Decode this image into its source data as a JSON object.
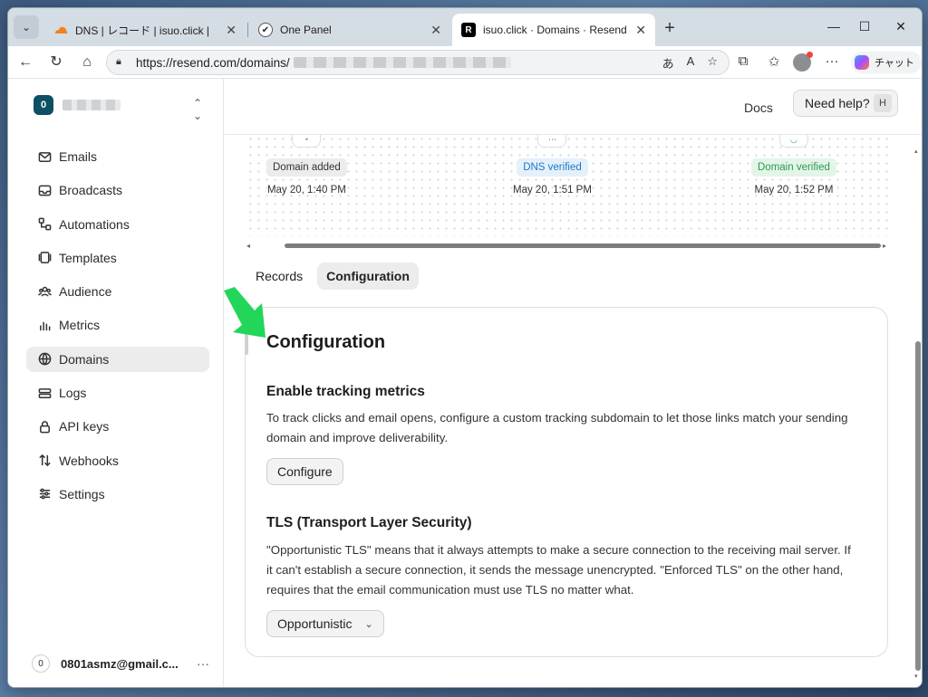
{
  "browser": {
    "tabs": [
      {
        "title": "DNS | レコード | isuo.click |",
        "favicon": "cloudflare-icon",
        "color": "#f38020"
      },
      {
        "title": "One Panel",
        "favicon": "one-panel-icon",
        "color": "#2b2b2b"
      },
      {
        "title": "isuo.click · Domains · Resend",
        "favicon": "resend-icon",
        "color": "#000000"
      }
    ],
    "url": "https://resend.com/domains/",
    "copilot_label": "チャット"
  },
  "sidebar": {
    "team_initial": "0",
    "items": [
      {
        "label": "Emails",
        "icon": "mail-icon"
      },
      {
        "label": "Broadcasts",
        "icon": "inbox-icon"
      },
      {
        "label": "Automations",
        "icon": "workflow-icon"
      },
      {
        "label": "Templates",
        "icon": "template-icon"
      },
      {
        "label": "Audience",
        "icon": "users-icon"
      },
      {
        "label": "Metrics",
        "icon": "bar-chart-icon"
      },
      {
        "label": "Domains",
        "icon": "globe-icon",
        "active": true
      },
      {
        "label": "Logs",
        "icon": "logs-icon"
      },
      {
        "label": "API keys",
        "icon": "lock-icon"
      },
      {
        "label": "Webhooks",
        "icon": "webhook-icon"
      },
      {
        "label": "Settings",
        "icon": "settings-icon"
      }
    ],
    "user": {
      "initial": "0",
      "email": "0801asmz@gmail.c...",
      "more": "···"
    }
  },
  "topbar": {
    "docs": "Docs",
    "help": "Need help?",
    "help_key": "H"
  },
  "timeline": [
    {
      "label": "Domain added",
      "time": "May 20, 1:40 PM",
      "style": "grey"
    },
    {
      "label": "DNS verified",
      "time": "May 20, 1:51 PM",
      "style": "blue"
    },
    {
      "label": "Domain verified",
      "time": "May 20, 1:52 PM",
      "style": "green"
    }
  ],
  "tabs": [
    {
      "label": "Records",
      "active": false
    },
    {
      "label": "Configuration",
      "active": true
    }
  ],
  "config": {
    "title": "Configuration",
    "tracking": {
      "heading": "Enable tracking metrics",
      "description": "To track clicks and email opens, configure a custom tracking subdomain to let those links match your sending domain and improve deliverability.",
      "button": "Configure"
    },
    "tls": {
      "heading": "TLS (Transport Layer Security)",
      "description": "\"Opportunistic TLS\" means that it always attempts to make a secure connection to the receiving mail server. If it can't establish a secure connection, it sends the message unencrypted. \"Enforced TLS\" on the other hand, requires that the email communication must use TLS no matter what.",
      "selected": "Opportunistic"
    }
  },
  "colors": {
    "accent_arrow": "#22d65a",
    "team_badge": "#0d4f63"
  }
}
